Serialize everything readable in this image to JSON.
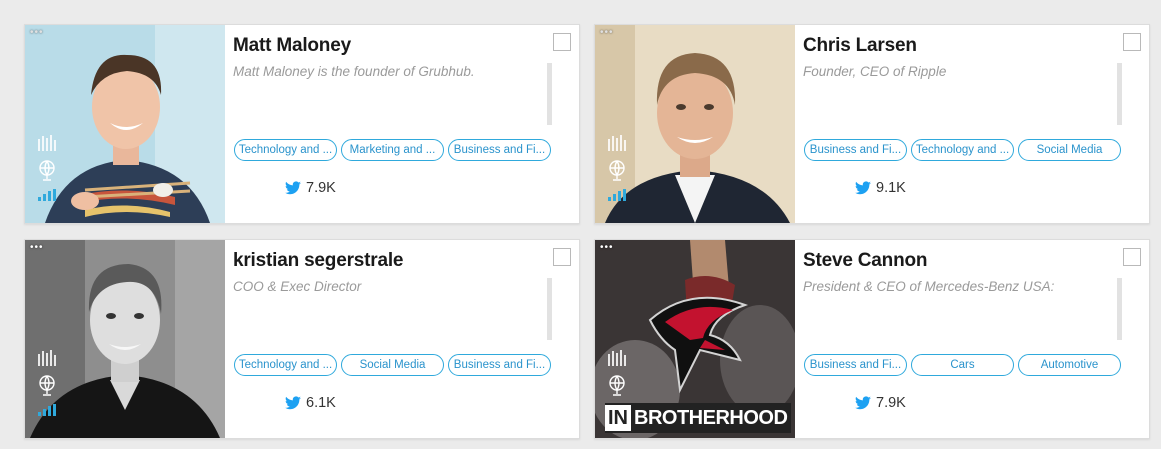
{
  "accent_color": "#2fa9dc",
  "twitter_color": "#1da1f2",
  "cards": [
    {
      "name": "Matt Maloney",
      "description": "Matt Maloney is the founder of Grubhub.",
      "tags": [
        "Technology and ...",
        "Marketing and ...",
        "Business and Fi..."
      ],
      "twitter_followers": "7.9K",
      "menu_dots": "•••",
      "icons": [
        "bars-icon",
        "globe-icon",
        "signal-icon"
      ]
    },
    {
      "name": "Chris Larsen",
      "description": "Founder, CEO of Ripple",
      "tags": [
        "Business and Fi...",
        "Technology and ...",
        "Social Media"
      ],
      "twitter_followers": "9.1K",
      "menu_dots": "•••",
      "icons": [
        "bars-icon",
        "globe-icon",
        "signal-icon"
      ]
    },
    {
      "name": "kristian segerstrale",
      "description": "COO & Exec Director",
      "tags": [
        "Technology and ...",
        "Social Media",
        "Business and Fi..."
      ],
      "twitter_followers": "6.1K",
      "menu_dots": "•••",
      "icons": [
        "bars-icon",
        "globe-icon",
        "signal-icon"
      ]
    },
    {
      "name": "Steve Cannon",
      "description": "President & CEO of Mercedes-Benz USA:",
      "tags": [
        "Business and Fi...",
        "Cars",
        "Automotive"
      ],
      "twitter_followers": "7.9K",
      "menu_dots": "•••",
      "icons": [
        "bars-icon",
        "globe-icon",
        "signal-icon"
      ],
      "photo_banner": {
        "box": "IN",
        "text": "BROTHERHOOD"
      }
    }
  ]
}
